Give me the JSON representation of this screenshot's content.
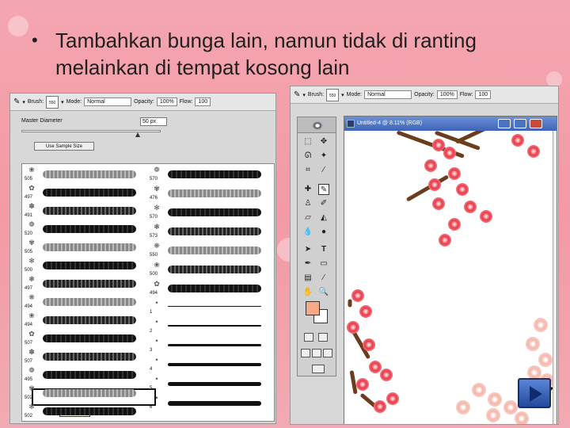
{
  "slide": {
    "bullet": "•",
    "title_line1": "Tambahkan bunga lain, namun tidak di ranting",
    "title_line2": "melainkan di tempat kosong lain"
  },
  "left_screenshot": {
    "options": {
      "brush_label": "Brush:",
      "brush_size": "550",
      "mode_label": "Mode:",
      "mode_value": "Normal",
      "opacity_label": "Opacity:",
      "opacity_value": "100%",
      "flow_label": "Flow:",
      "flow_value": "100"
    },
    "master_diameter_label": "Master Diameter",
    "master_diameter_value": "50 px",
    "use_sample_size": "Use Sample Size",
    "brush_numbers_col1": [
      "505",
      "497",
      "491",
      "520",
      "505",
      "500",
      "497",
      "494",
      "494",
      "507",
      "507",
      "495",
      "502",
      "502"
    ],
    "brush_numbers_col2": [
      "570",
      "476",
      "570",
      "573",
      "550",
      "500",
      "494",
      "1",
      "2",
      "3",
      "4",
      "5",
      "6"
    ],
    "tooltip": "Flower 00"
  },
  "right_screenshot": {
    "options": {
      "brush_label": "Brush:",
      "brush_size": "550",
      "mode_label": "Mode:",
      "mode_value": "Normal",
      "opacity_label": "Opacity:",
      "opacity_value": "100%",
      "flow_label": "Flow:",
      "flow_value": "100"
    },
    "document_title": "Untitled-4 @ 8.11% (RGB)",
    "tool_t": "T",
    "foreground_color": "#f7a987"
  },
  "icons": {
    "brush": "paintbrush-icon",
    "dropdown": "chevron-down-icon",
    "next": "next-arrow-icon"
  }
}
